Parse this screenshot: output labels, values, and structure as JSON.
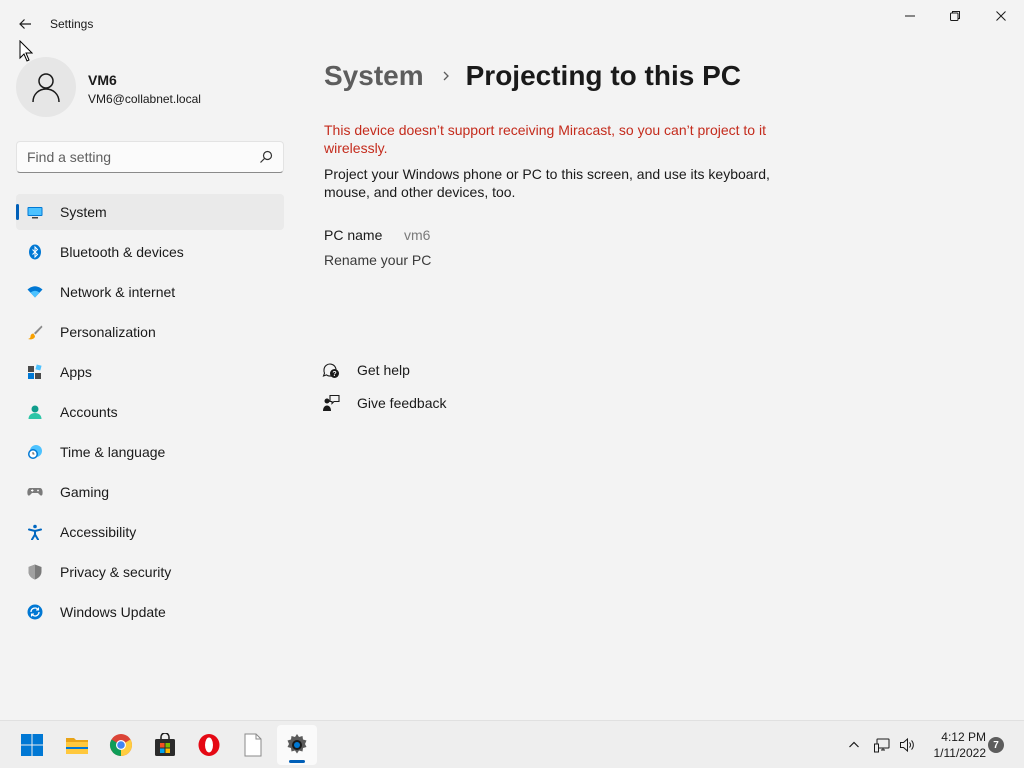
{
  "window": {
    "title": "Settings"
  },
  "profile": {
    "name": "VM6",
    "email": "VM6@collabnet.local"
  },
  "search": {
    "placeholder": "Find a setting"
  },
  "sidebar": {
    "items": [
      {
        "label": "System",
        "icon": "system-icon",
        "selected": true
      },
      {
        "label": "Bluetooth & devices",
        "icon": "bluetooth-icon"
      },
      {
        "label": "Network & internet",
        "icon": "wifi-icon"
      },
      {
        "label": "Personalization",
        "icon": "paintbrush-icon"
      },
      {
        "label": "Apps",
        "icon": "apps-icon"
      },
      {
        "label": "Accounts",
        "icon": "accounts-icon"
      },
      {
        "label": "Time & language",
        "icon": "time-language-icon"
      },
      {
        "label": "Gaming",
        "icon": "gamepad-icon"
      },
      {
        "label": "Accessibility",
        "icon": "accessibility-icon"
      },
      {
        "label": "Privacy & security",
        "icon": "shield-icon"
      },
      {
        "label": "Windows Update",
        "icon": "windows-update-icon"
      }
    ]
  },
  "main": {
    "breadcrumb_parent": "System",
    "page_title": "Projecting to this PC",
    "warning": "This device doesn’t support receiving Miracast, so you can’t project to it wirelessly.",
    "description": "Project your Windows phone or PC to this screen, and use its keyboard, mouse, and other devices, too.",
    "pc_name_label": "PC name",
    "pc_name_value": "vm6",
    "rename_link": "Rename your PC",
    "get_help": "Get help",
    "give_feedback": "Give feedback"
  },
  "taskbar": {
    "apps": [
      "start-icon",
      "file-explorer-icon",
      "chrome-icon",
      "store-icon",
      "opera-icon",
      "notepad-icon",
      "settings-icon"
    ],
    "time": "4:12 PM",
    "date": "1/11/2022",
    "notification_count": "7"
  },
  "colors": {
    "accent": "#005fb8",
    "warning": "#c42b1c",
    "background": "#f3f3f3"
  }
}
